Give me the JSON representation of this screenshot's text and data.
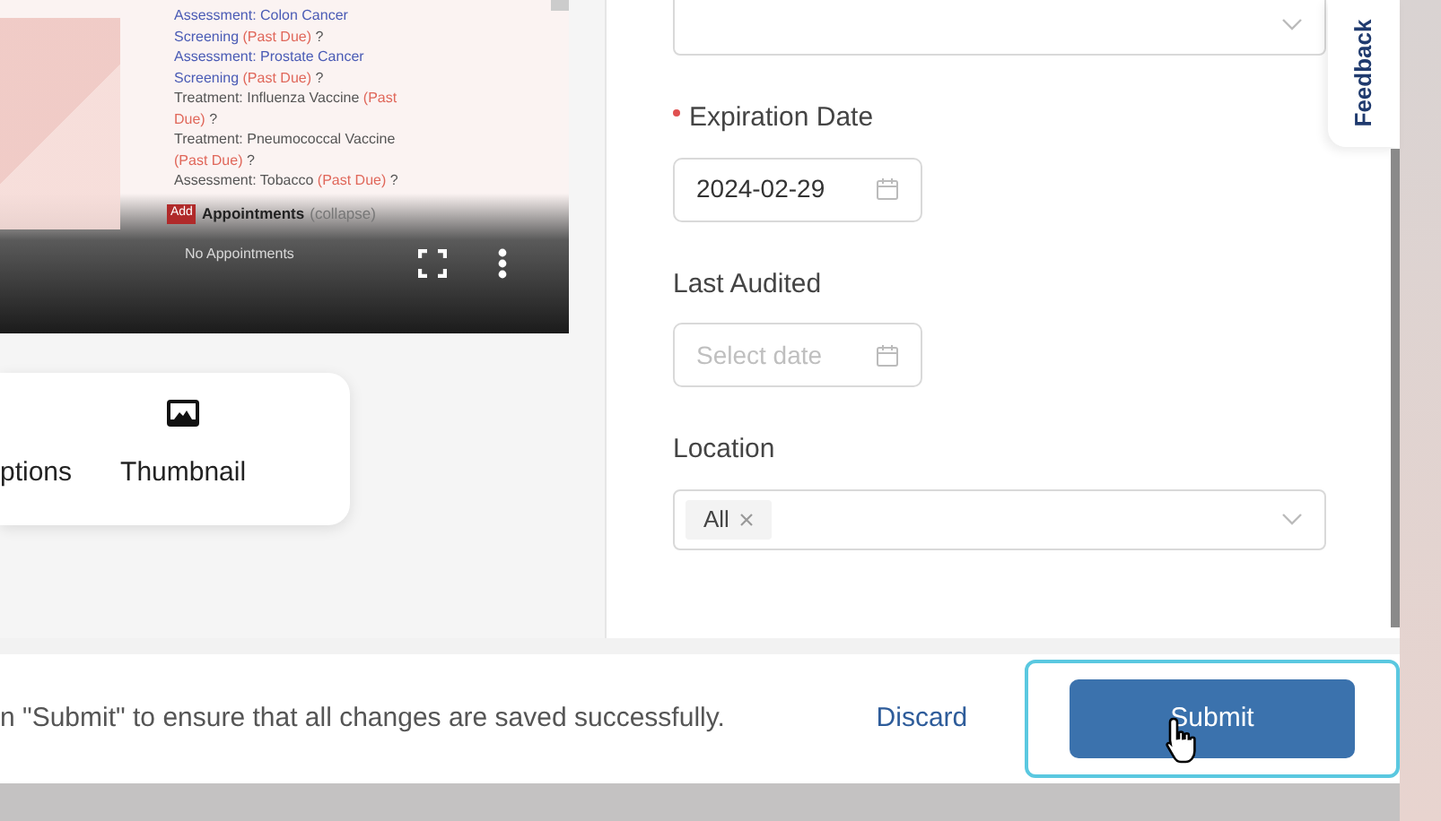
{
  "video": {
    "reminders": [
      {
        "kind": "link",
        "name": "Assessment: Colon Cancer Screening",
        "status": "(Past Due)",
        "suffix": "?"
      },
      {
        "kind": "link",
        "name": "Assessment: Prostate Cancer Screening",
        "status": "(Past Due)",
        "suffix": "?"
      },
      {
        "kind": "plain",
        "name": "Treatment: Influenza Vaccine",
        "status": "(Past Due)",
        "suffix": "?"
      },
      {
        "kind": "plain",
        "name": "Treatment: Pneumococcal Vaccine",
        "status": "(Past Due)",
        "suffix": "?"
      },
      {
        "kind": "plain",
        "name": "Assessment: Tobacco",
        "status": "(Past Due)",
        "suffix": "?"
      }
    ],
    "section": {
      "badge": "Add",
      "title": "Appointments",
      "toggle": "(collapse)"
    },
    "empty_text": "No Appointments"
  },
  "video_tools": [
    {
      "label": "ptions",
      "kind": "text"
    },
    {
      "label": "Thumbnail",
      "kind": "image"
    }
  ],
  "form": {
    "fields": [
      {
        "kind": "select"
      },
      {
        "kind": "date",
        "label": "Expiration Date",
        "required": true,
        "value": "2024-02-29"
      },
      {
        "kind": "date",
        "label": "Last Audited",
        "required": false,
        "placeholder": "Select date"
      },
      {
        "kind": "multiselect",
        "label": "Location",
        "required": false,
        "tags": [
          "All"
        ]
      }
    ]
  },
  "feedback_tab": "Feedback",
  "footer": {
    "message": "n \"Submit\" to ensure that all changes are saved successfully.",
    "discard": "Discard",
    "submit": "Submit",
    "submit_focused": true
  }
}
